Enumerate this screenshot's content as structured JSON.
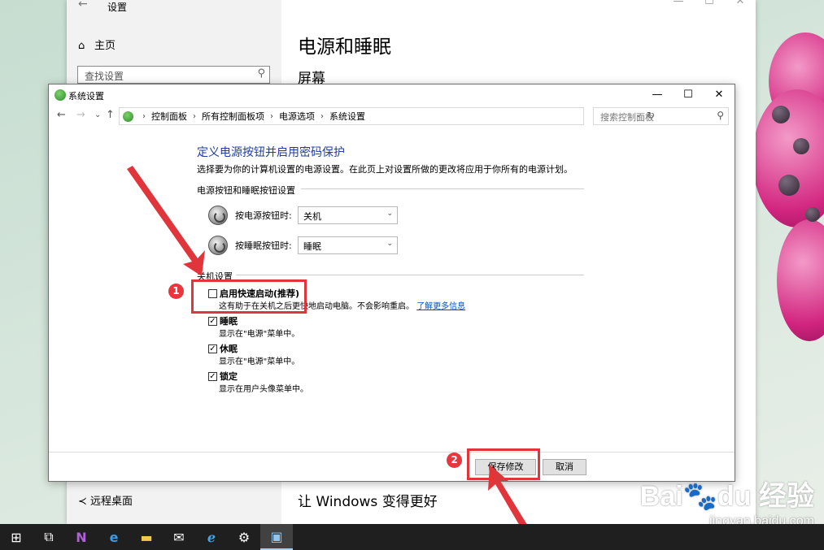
{
  "settings_window": {
    "title": "设置",
    "home_label": "主页",
    "search_placeholder": "查找设置",
    "page_title": "电源和睡眠",
    "section_screen": "屏幕",
    "left_bottom_item": "远程桌面",
    "bottom_heading": "让 Windows 变得更好"
  },
  "dialog": {
    "title": "系统设置",
    "breadcrumb": [
      "控制面板",
      "所有控制面板项",
      "电源选项",
      "系统设置"
    ],
    "search_placeholder": "搜索控制面板",
    "heading": "定义电源按钮并启用密码保护",
    "description": "选择要为你的计算机设置的电源设置。在此页上对设置所做的更改将应用于你所有的电源计划。",
    "power_group_label": "电源按钮和睡眠按钮设置",
    "power_button_label": "按电源按钮时:",
    "power_button_value": "关机",
    "sleep_button_label": "按睡眠按钮时:",
    "sleep_button_value": "睡眠",
    "shutdown_group_label": "关机设置",
    "options": [
      {
        "label": "启用快速启动(推荐)",
        "checked": false,
        "sub": "这有助于在关机之后更快地启动电脑。不会影响重启。",
        "link": "了解更多信息"
      },
      {
        "label": "睡眠",
        "checked": true,
        "sub": "显示在\"电源\"菜单中。"
      },
      {
        "label": "休眠",
        "checked": true,
        "sub": "显示在\"电源\"菜单中。"
      },
      {
        "label": "锁定",
        "checked": true,
        "sub": "显示在用户头像菜单中。"
      }
    ],
    "save_button": "保存修改",
    "cancel_button": "取消"
  },
  "annotations": {
    "badge1": "1",
    "badge2": "2",
    "color": "#e0363b"
  },
  "watermark": {
    "main": "Bai🐾du 经验",
    "sub": "jingyan.baidu.com"
  },
  "taskbar": {
    "icons": [
      "windows-start-icon",
      "task-view-icon",
      "onenote-icon",
      "edge-icon",
      "file-explorer-icon",
      "mail-icon",
      "internet-explorer-icon",
      "settings-gear-icon",
      "control-panel-icon"
    ]
  }
}
